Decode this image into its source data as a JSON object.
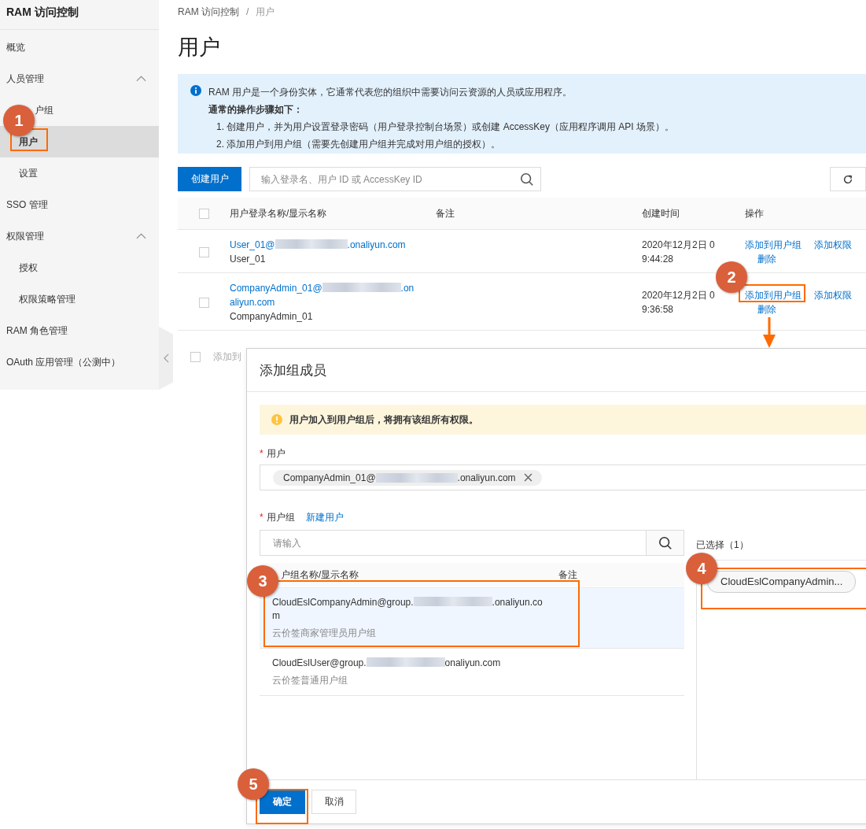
{
  "sidebar": {
    "title": "RAM 访问控制",
    "items": [
      {
        "label": "概览",
        "kind": "link",
        "selected": false
      },
      {
        "label": "人员管理",
        "kind": "section",
        "selected": false,
        "expanded": true,
        "children": [
          {
            "label": "户组",
            "kind": "covered",
            "selected": false
          },
          {
            "label": "用户",
            "kind": "link",
            "selected": true
          },
          {
            "label": "设置",
            "kind": "link",
            "selected": false
          }
        ]
      },
      {
        "label": "SSO 管理",
        "kind": "link",
        "selected": false
      },
      {
        "label": "权限管理",
        "kind": "section",
        "selected": false,
        "expanded": true,
        "children": [
          {
            "label": "授权",
            "kind": "link",
            "selected": false
          },
          {
            "label": "权限策略管理",
            "kind": "link",
            "selected": false
          }
        ]
      },
      {
        "label": "RAM 角色管理",
        "kind": "link",
        "selected": false
      },
      {
        "label": "OAuth 应用管理（公测中）",
        "kind": "link",
        "selected": false
      }
    ]
  },
  "breadcrumb": {
    "items": [
      "RAM 访问控制",
      "用户"
    ],
    "separator": "/"
  },
  "page_title": "用户",
  "info": {
    "intro": "RAM 用户是一个身份实体，它通常代表您的组织中需要访问云资源的人员或应用程序。",
    "steps_title": "通常的操作步骤如下：",
    "steps": [
      "1. 创建用户，并为用户设置登录密码（用户登录控制台场景）或创建 AccessKey（应用程序调用 API 场景）。",
      "2. 添加用户到用户组（需要先创建用户组并完成对用户组的授权）。"
    ]
  },
  "toolbar": {
    "create_button": "创建用户",
    "search": {
      "placeholder": "输入登录名、用户 ID 或 AccessKey ID"
    }
  },
  "table": {
    "header_checked": false,
    "columns": [
      "用户登录名称/显示名称",
      "备注",
      "创建时间",
      "操作"
    ],
    "rows": [
      {
        "checked": false,
        "login_prefix": "User_01@",
        "login_suffix": ".onaliyun.com",
        "display_name": "User_01",
        "created": "2020年12月2日 09:44:28",
        "actions": [
          "添加到用户组",
          "添加权限",
          "删除"
        ]
      },
      {
        "checked": false,
        "login_prefix": "CompanyAdmin_01@",
        "login_suffix": ".onaliyun.com",
        "display_name": "CompanyAdmin_01",
        "created": "2020年12月2日 09:36:58",
        "actions": [
          "添加到用户组",
          "添加权限",
          "删除"
        ]
      }
    ],
    "footer": {
      "checked": false,
      "label": "添加到"
    }
  },
  "dialog": {
    "title": "添加组成员",
    "warning": "用户加入到用户组后，将拥有该组所有权限。",
    "user_field": {
      "label": "用户",
      "required_mark": "*",
      "tag": {
        "prefix": "CompanyAdmin_01@",
        "suffix": ".onaliyun.com"
      }
    },
    "group_field": {
      "label": "用户组",
      "required_mark": "*",
      "link": "新建用户",
      "search": {
        "placeholder": "请输入"
      }
    },
    "group_table": {
      "columns": [
        {
          "label": "户组名称/显示名称",
          "kind": "covered"
        },
        {
          "label": "备注",
          "kind": "plain"
        }
      ],
      "rows": [
        {
          "name_prefix": "CloudEslCompanyAdmin@group.",
          "name_suffix": ".onaliyun.com",
          "display_name": "云价签商家管理员用户组",
          "selected": true
        },
        {
          "name_prefix": "CloudEslUser@group.",
          "name_suffix": "onaliyun.com",
          "display_name": "云价签普通用户组",
          "selected": false
        }
      ]
    },
    "selected_panel": {
      "title": "已选择（1）",
      "items": [
        "CloudEslCompanyAdmin..."
      ]
    },
    "buttons": [
      {
        "label": "确定",
        "kind": "primary"
      },
      {
        "label": "取消",
        "kind": "default"
      }
    ]
  },
  "annotations": [
    {
      "number": "1"
    },
    {
      "number": "2"
    },
    {
      "number": "3"
    },
    {
      "number": "4"
    },
    {
      "number": "5"
    }
  ]
}
